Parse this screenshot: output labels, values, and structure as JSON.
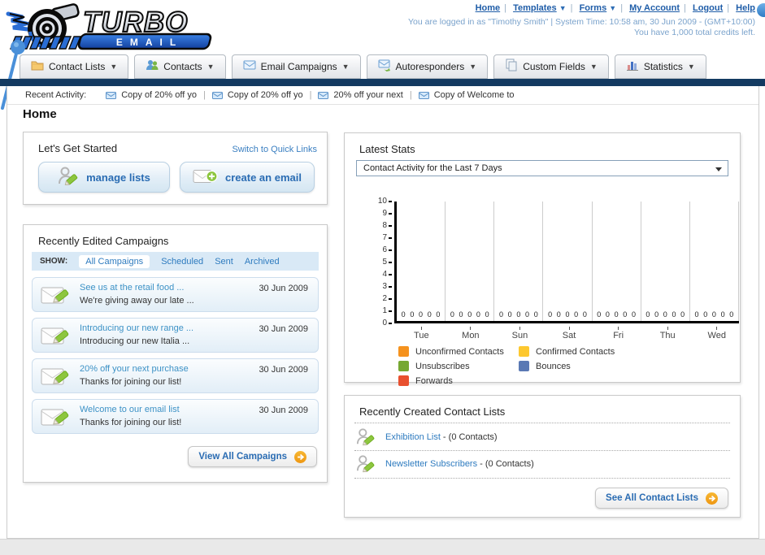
{
  "header": {
    "logo_title": "TURBO",
    "logo_subtitle": "EMAIL",
    "nav": [
      {
        "label": "Home"
      },
      {
        "label": "Templates"
      },
      {
        "label": "Forms"
      },
      {
        "label": "My Account"
      },
      {
        "label": "Logout"
      },
      {
        "label": "Help"
      }
    ],
    "login_line": "You are logged in as \"Timothy Smith\" | System Time: 10:58 am, 30 Jun 2009 - (GMT+10:00)",
    "credits_line": "You have 1,000 total credits left."
  },
  "tabs": [
    {
      "label": "Contact Lists",
      "icon": "folder-icon"
    },
    {
      "label": "Contacts",
      "icon": "people-icon"
    },
    {
      "label": "Email Campaigns",
      "icon": "envelope-icon"
    },
    {
      "label": "Autoresponders",
      "icon": "envelope-arrow-icon"
    },
    {
      "label": "Custom Fields",
      "icon": "pages-icon"
    },
    {
      "label": "Statistics",
      "icon": "bar-chart-icon"
    }
  ],
  "recent_activity": {
    "label": "Recent Activity:",
    "items": [
      {
        "text": "Copy of 20% off yo"
      },
      {
        "text": "Copy of 20% off yo"
      },
      {
        "text": "20% off your next"
      },
      {
        "text": "Copy of Welcome to"
      }
    ]
  },
  "page_title": "Home",
  "get_started": {
    "title": "Let's Get Started",
    "switch_link": "Switch to Quick Links",
    "manage_lists_label": "manage lists",
    "create_email_label": "create an email"
  },
  "campaigns": {
    "title": "Recently Edited Campaigns",
    "show_label": "SHOW:",
    "filters": [
      {
        "label": "All Campaigns"
      },
      {
        "label": "Scheduled"
      },
      {
        "label": "Sent"
      },
      {
        "label": "Archived"
      }
    ],
    "active_filter": "All Campaigns",
    "items": [
      {
        "title": "See us at the retail food ...",
        "subtitle": "We're giving away our late ...",
        "date": "30 Jun 2009"
      },
      {
        "title": "Introducing our new range ...",
        "subtitle": "Introducing our new Italia ...",
        "date": "30 Jun 2009"
      },
      {
        "title": "20% off your next purchase",
        "subtitle": "Thanks for joining our list!",
        "date": "30 Jun 2009"
      },
      {
        "title": "Welcome to our email list",
        "subtitle": "Thanks for joining our list!",
        "date": "30 Jun 2009"
      }
    ],
    "view_all_label": "View All Campaigns"
  },
  "stats": {
    "title": "Latest Stats",
    "dropdown_value": "Contact Activity for the Last 7 Days"
  },
  "chart_data": {
    "type": "bar",
    "title": "Contact Activity for the Last 7 Days",
    "categories": [
      "Tue",
      "Mon",
      "Sun",
      "Sat",
      "Fri",
      "Thu",
      "Wed"
    ],
    "series": [
      {
        "name": "Unconfirmed Contacts",
        "color": "#F5921E",
        "values": [
          0,
          0,
          0,
          0,
          0,
          0,
          0
        ]
      },
      {
        "name": "Confirmed Contacts",
        "color": "#FDC82F",
        "values": [
          0,
          0,
          0,
          0,
          0,
          0,
          0
        ]
      },
      {
        "name": "Unsubscribes",
        "color": "#76A832",
        "values": [
          0,
          0,
          0,
          0,
          0,
          0,
          0
        ]
      },
      {
        "name": "Bounces",
        "color": "#5A79B4",
        "values": [
          0,
          0,
          0,
          0,
          0,
          0,
          0
        ]
      },
      {
        "name": "Forwards",
        "color": "#E8502F",
        "values": [
          0,
          0,
          0,
          0,
          0,
          0,
          0
        ]
      }
    ],
    "ylim": [
      0,
      10
    ],
    "yticks": [
      0,
      1,
      2,
      3,
      4,
      5,
      6,
      7,
      8,
      9,
      10
    ],
    "grid": true,
    "legend_position": "bottom"
  },
  "contact_lists": {
    "title": "Recently Created Contact Lists",
    "items": [
      {
        "name": "Exhibition List",
        "suffix": " - (0 Contacts)"
      },
      {
        "name": "Newsletter Subscribers",
        "suffix": " - (0 Contacts)"
      }
    ],
    "see_all_label": "See All Contact Lists"
  },
  "colors": {
    "navy_bar": "#133a61",
    "link_blue": "#2e7bbf",
    "button_text_blue": "#2a6cb3",
    "go_arrow_orange": "#ee9611",
    "logo_blue": "#2a6dd4"
  }
}
